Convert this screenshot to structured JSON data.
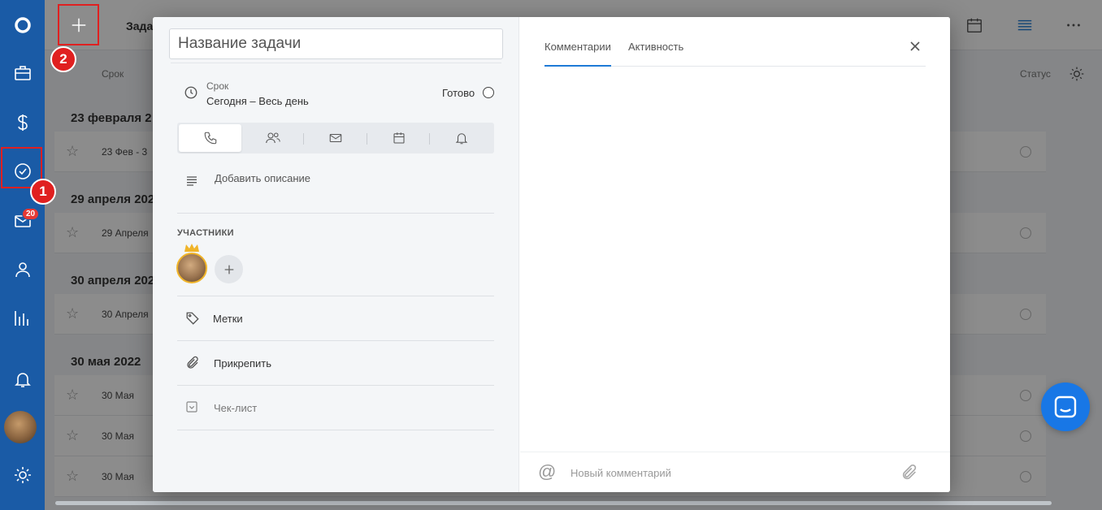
{
  "app": {
    "section_title": "Зада",
    "columns": {
      "due": "Срок",
      "status": "Статус"
    },
    "groups": [
      {
        "title": "23 февраля 2",
        "rows": [
          "23 Фев - 3"
        ]
      },
      {
        "title": "29 апреля 202",
        "rows": [
          "29 Апреля"
        ]
      },
      {
        "title": "30 апреля 202",
        "rows": [
          "30 Апреля"
        ]
      },
      {
        "title": "30 мая 2022",
        "rows": [
          "30 Мая",
          "30 Мая",
          "30 Мая"
        ]
      }
    ]
  },
  "nav": {
    "mail_badge": "20"
  },
  "callouts": {
    "first": "1",
    "second": "2"
  },
  "task": {
    "title_placeholder": "Название задачи",
    "due_label": "Срок",
    "due_value": "Сегодня – Весь день",
    "done_label": "Готово",
    "add_description": "Добавить описание",
    "participants_title": "УЧАСТНИКИ",
    "tags": "Метки",
    "attach": "Прикрепить",
    "checklist": "Чек-лист"
  },
  "panel": {
    "tabs": [
      "Комментарии",
      "Активность"
    ],
    "active_tab": "Комментарии",
    "comment_placeholder": "Новый комментарий",
    "at_symbol": "@"
  },
  "colors": {
    "nav_bg": "#1a5ba6",
    "accent": "#1e7ad6",
    "callout": "#e02020",
    "crown": "#f0b429"
  }
}
